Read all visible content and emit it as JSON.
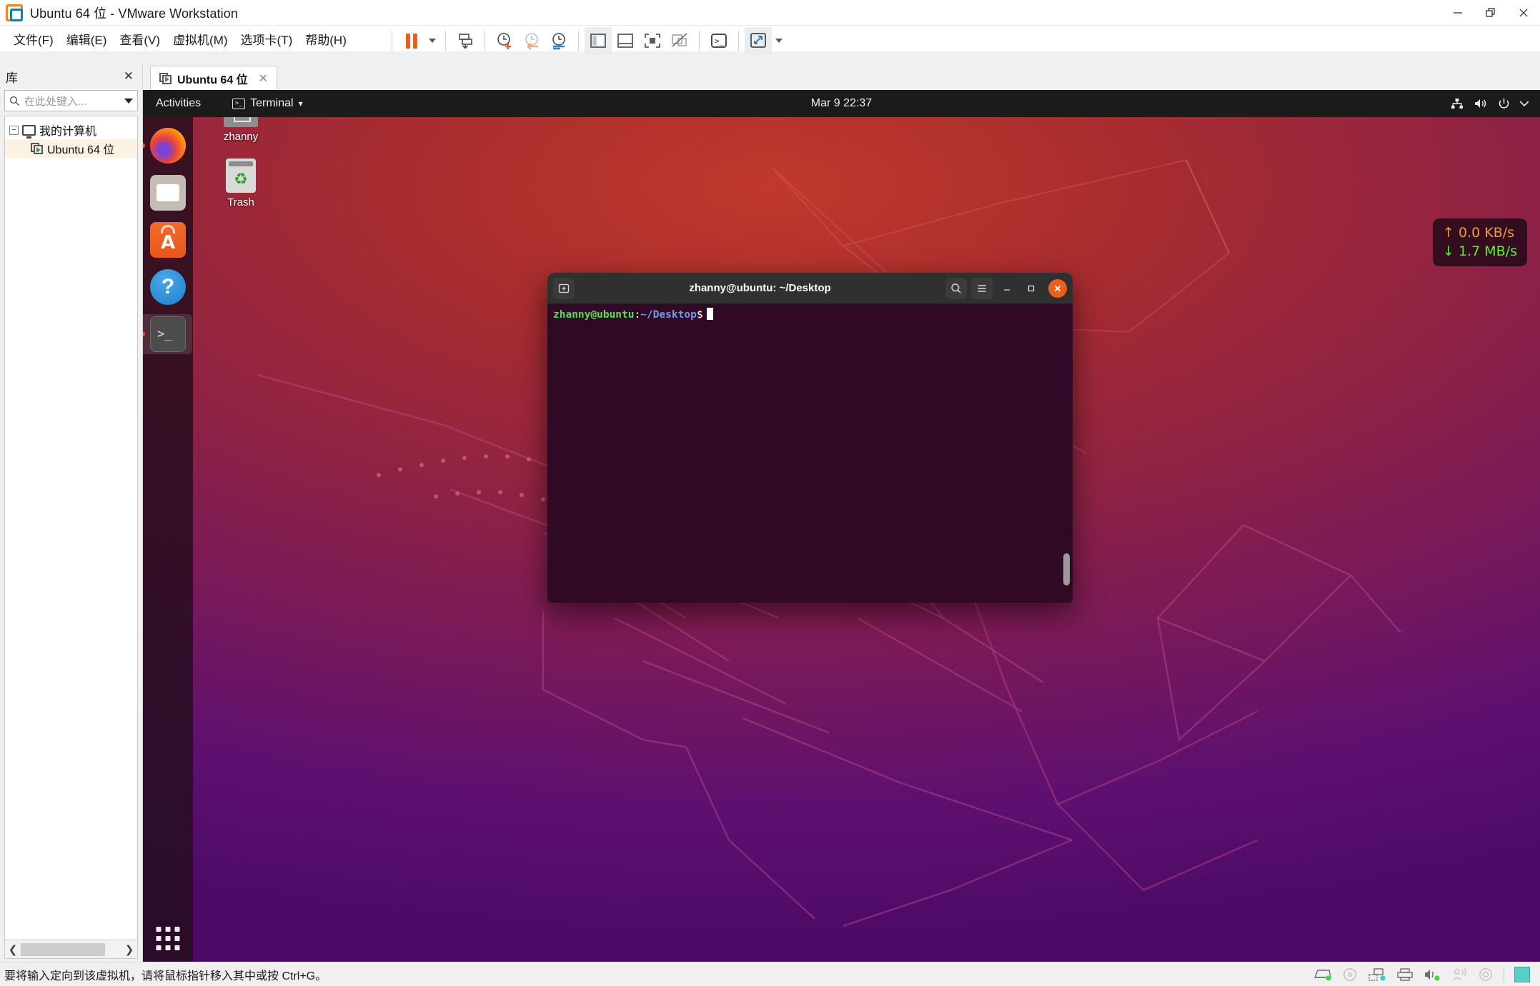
{
  "window": {
    "title": "Ubuntu 64 位 - VMware Workstation",
    "controls": {
      "minimize": "—",
      "restore": "❐",
      "close": "✕"
    }
  },
  "menubar": {
    "items": [
      {
        "label": "文件(F)",
        "name": "menu-file"
      },
      {
        "label": "编辑(E)",
        "name": "menu-edit"
      },
      {
        "label": "查看(V)",
        "name": "menu-view"
      },
      {
        "label": "虚拟机(M)",
        "name": "menu-vm"
      },
      {
        "label": "选项卡(T)",
        "name": "menu-tabs"
      },
      {
        "label": "帮助(H)",
        "name": "menu-help"
      }
    ]
  },
  "toolbar": {
    "icons": [
      "pause-icon",
      "dropdown-caret-icon",
      "send-ctrl-alt-del-icon",
      "snapshot-take-icon",
      "snapshot-revert-icon",
      "snapshot-manager-icon",
      "show-library-icon",
      "show-thumbnail-bar-icon",
      "show-console-view-icon",
      "full-screen-off-icon",
      "unity-mode-icon",
      "stretch-guest-icon",
      "toolbar-caret-icon"
    ]
  },
  "sidebar": {
    "title": "库",
    "close_label": "✕",
    "search": {
      "placeholder": "在此处键入...",
      "value": ""
    },
    "tree": [
      {
        "label": "我的计算机",
        "level": 1,
        "expander": "−",
        "icon": "monitor-icon"
      },
      {
        "label": "Ubuntu 64 位",
        "level": 2,
        "icon": "vm-icon",
        "selected": true
      }
    ],
    "scroll": {
      "left_arrow": "❮",
      "right_arrow": "❯"
    }
  },
  "tabs": [
    {
      "label": "Ubuntu 64 位",
      "close": "✕",
      "active": true
    }
  ],
  "ubuntu": {
    "topbar": {
      "activities": "Activities",
      "app_menu": "Terminal",
      "app_menu_caret": "▾",
      "clock": "Mar 9  22:37",
      "tray": [
        "network-icon",
        "volume-icon",
        "power-icon",
        "tray-caret-icon"
      ]
    },
    "dock": [
      {
        "name": "dock-item-firefox",
        "label": "Firefox",
        "running": true,
        "active": false
      },
      {
        "name": "dock-item-files",
        "label": "Files",
        "running": false,
        "active": false
      },
      {
        "name": "dock-item-software",
        "label": "Ubuntu Software",
        "running": false,
        "active": false
      },
      {
        "name": "dock-item-help",
        "label": "Help",
        "running": false,
        "active": false
      },
      {
        "name": "dock-item-terminal",
        "label": "Terminal",
        "running": true,
        "active": true
      }
    ],
    "app_grid_label": "Show Applications",
    "desktop_icons": [
      {
        "name": "desktop-icon-home",
        "label": "zhanny",
        "icon": "home-folder-icon"
      },
      {
        "name": "desktop-icon-trash",
        "label": "Trash",
        "icon": "trash-icon"
      }
    ],
    "netspeed": {
      "upload": "0.0 KB/s",
      "download": "1.7 MB/s",
      "up_arrow": "↑",
      "down_arrow": "↓",
      "up_color": "#f0a030",
      "down_color": "#5ef028"
    }
  },
  "terminal": {
    "title": "zhanny@ubuntu: ~/Desktop",
    "new_tab_label": "⊞",
    "search_label": "⌕",
    "menu_label": "☰",
    "minimize_label": "—",
    "maximize_label": "□",
    "close_label": "✕",
    "prompt": {
      "user_host": "zhanny@ubuntu",
      "colon": ":",
      "path": "~/Desktop",
      "symbol": "$"
    },
    "output": ""
  },
  "statusbar": {
    "message": "要将输入定向到该虚拟机，请将鼠标指针移入其中或按 Ctrl+G。",
    "devices": [
      "hard-disk-icon",
      "cd-dvd-icon",
      "network-adapter-icon",
      "printer-icon",
      "sound-card-icon",
      "usb-device-icon",
      "camera-icon",
      "note-icon"
    ]
  },
  "colors": {
    "ubuntu_orange": "#e8601c",
    "terminal_bg": "#300a24",
    "topbar_bg": "#1d1b1a",
    "prompt_green": "#4ee44e",
    "prompt_blue": "#6d9eeb"
  }
}
